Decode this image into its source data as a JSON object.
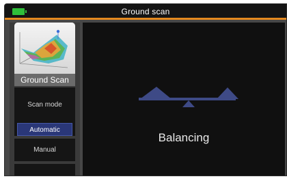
{
  "window": {
    "title": "Ground scan",
    "battery_color": "#2fbf3a",
    "accent_color": "#e58a1f"
  },
  "sidebar": {
    "mode_card": {
      "label": "Ground Scan",
      "icon": "surface-plot-icon"
    },
    "section_label": "Scan mode",
    "options": [
      {
        "label": "Automatic",
        "selected": true
      },
      {
        "label": "Manual",
        "selected": false
      }
    ]
  },
  "main": {
    "status": "Balancing",
    "indicator_icon": "balance-scale-icon",
    "indicator_color": "#3e4a86"
  }
}
